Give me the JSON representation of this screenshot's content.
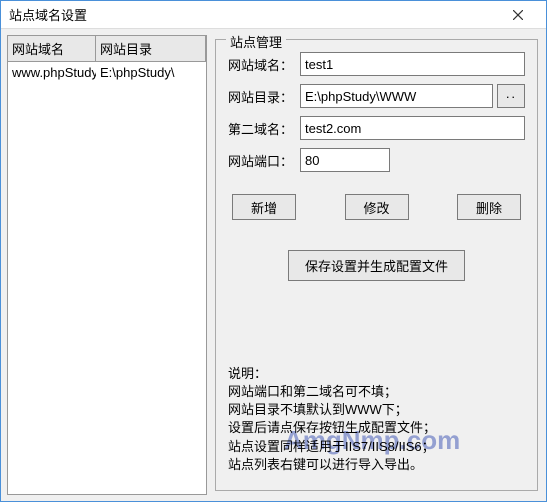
{
  "window": {
    "title": "站点域名设置"
  },
  "table": {
    "headers": {
      "domain": "网站域名",
      "directory": "网站目录"
    },
    "rows": [
      {
        "domain": "www.phpStudy",
        "directory": "E:\\phpStudy\\"
      }
    ]
  },
  "groupbox": {
    "title": "站点管理",
    "labels": {
      "domain": "网站域名：",
      "directory": "网站目录：",
      "second_domain": "第二域名：",
      "port": "网站端口："
    },
    "values": {
      "domain": "test1",
      "directory": "E:\\phpStudy\\WWW",
      "second_domain": "test2.com",
      "port": "80"
    },
    "browse": "··",
    "buttons": {
      "add": "新增",
      "modify": "修改",
      "delete": "删除",
      "save": "保存设置并生成配置文件"
    }
  },
  "notes": {
    "title": "说明：",
    "line1": "网站端口和第二域名可不填；",
    "line2": "网站目录不填默认到WWW下；",
    "line3": "设置后请点保存按钮生成配置文件；",
    "line4": "站点设置同样适用于IIS7/IIS8/IIS6；",
    "line5": "站点列表右键可以进行导入导出。"
  },
  "watermark": "AmgNmp.com"
}
